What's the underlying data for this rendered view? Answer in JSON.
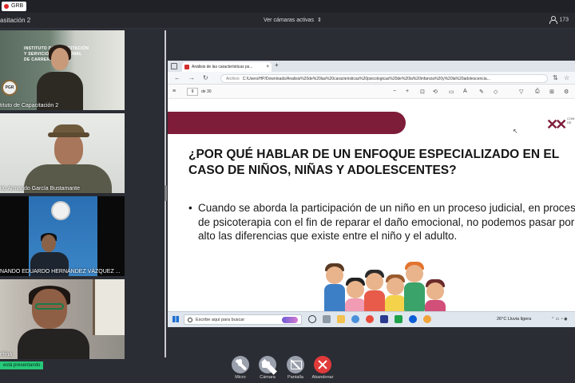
{
  "recording": {
    "label": "GRB"
  },
  "titlebar": {
    "meeting_name": "asitación 2",
    "view_mode": "Ver cámaras activas",
    "view_mode_arrows": "⇕",
    "participant_count": "173"
  },
  "participants": [
    {
      "name": "tituto de Capacitación 2",
      "org_text": "INSTITUTO DE CAPACITACIÓN\nY SERVICIO PROFESIONAL\nDE CARRERA",
      "logo_text": "PGR"
    },
    {
      "name": "rio Armando García Bustamante"
    },
    {
      "name": "NANDO EDUARDO HERNÁNDEZ VÁZQUEZ ..."
    },
    {
      "name": "efina"
    }
  ],
  "presenting_label": "está presentando",
  "browser": {
    "tab_title": "Análisis de las características ps...",
    "tab_close": "×",
    "new_tab": "+",
    "address_label": "Archivo",
    "url": "C:/Users/HP/Downloads/Analisis%20de%20las%20caracteristicas%20psicologicas%20de%20la%20infancia%20y%20la%20adolescencia...",
    "page_current": "9",
    "page_total": "de 30"
  },
  "slide": {
    "heading": "¿POR QUÉ HABLAR DE UN ENFOQUE ESPECIALIZADO EN EL CASO DE NIÑOS, NIÑAS Y ADOLESCENTES?",
    "bullet": "Cuando se aborda la participación de un niño en un proceso judicial, en proceso de psicoterapia con el fin de reparar el daño emocional, no podemos pasar por alto las diferencias que existe entre el niño y el adulto.",
    "logo_text": "COM\nDE"
  },
  "taskbar": {
    "search_placeholder": "Escribe aquí para buscar",
    "weather": "26°C  Lluvia ligera"
  },
  "controls": {
    "mic": "Micro",
    "camera": "Cámara",
    "screen": "Pantalla",
    "leave": "Abandonar"
  }
}
